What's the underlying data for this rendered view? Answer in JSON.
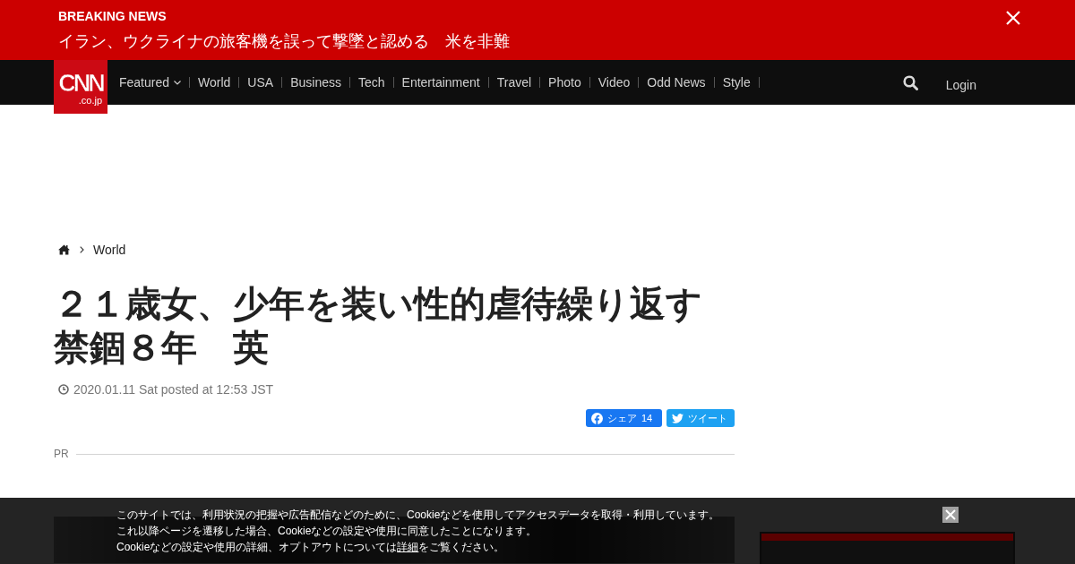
{
  "breaking_news": {
    "label": "BREAKING NEWS",
    "headline": "イラン、ウクライナの旅客機を誤って撃墜と認める　米を非難"
  },
  "navbar": {
    "logo": {
      "text": "CNN",
      "suffix": ".co.jp"
    },
    "items": [
      {
        "label": "Featured",
        "kind": "dropdown"
      },
      {
        "label": "World",
        "kind": "link"
      },
      {
        "label": "USA",
        "kind": "link"
      },
      {
        "label": "Business",
        "kind": "link"
      },
      {
        "label": "Tech",
        "kind": "link"
      },
      {
        "label": "Entertainment",
        "kind": "link"
      },
      {
        "label": "Travel",
        "kind": "link"
      },
      {
        "label": "Photo",
        "kind": "link"
      },
      {
        "label": "Video",
        "kind": "link"
      },
      {
        "label": "Odd News",
        "kind": "link"
      },
      {
        "label": "Style",
        "kind": "link"
      }
    ],
    "login": "Login"
  },
  "breadcrumb": {
    "items": [
      "World"
    ]
  },
  "article": {
    "title": "２１歳女、少年を装い性的虐待繰り返す禁錮８年　英",
    "date": "2020.01.11 Sat posted at 12:53 JST",
    "share_buttons": [
      {
        "kind": "facebook",
        "label": "シェア",
        "count": "14"
      },
      {
        "kind": "twitter",
        "label": "ツイート"
      }
    ],
    "pr_label": "PR"
  },
  "cookie_notice": {
    "lines": [
      "このサイトでは、利用状況の把握や広告配信などのために、Cookieなどを使用してアクセスデータを取得・利用しています。",
      "これ以降ページを遷移した場合、Cookieなどの設定や使用に同意したことになります。"
    ],
    "last_line": {
      "before": "Cookieなどの設定や使用の詳細、オプトアウトについては",
      "link": "詳細",
      "after": "をご覧ください。"
    }
  }
}
